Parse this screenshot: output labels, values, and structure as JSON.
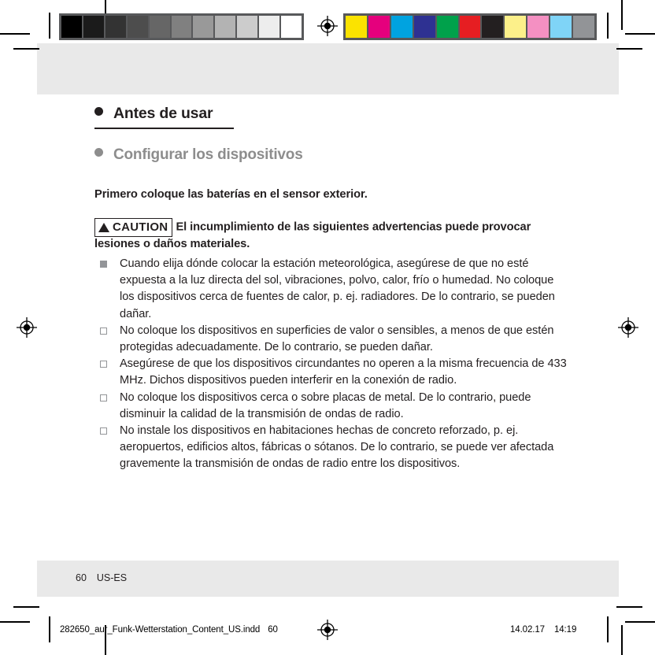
{
  "document": {
    "page_number": "60",
    "language_code": "US-ES"
  },
  "print_strips": {
    "grayscale_label": "grayscale-control-strip",
    "grayscale_swatches": [
      "#000000",
      "#1b1b1b",
      "#333333",
      "#4d4d4d",
      "#666666",
      "#808080",
      "#999999",
      "#b3b3b3",
      "#cccccc",
      "#ededed",
      "#ffffff"
    ],
    "color_label": "color-control-strip",
    "color_swatches": [
      "#fbe300",
      "#e5007d",
      "#00a3e0",
      "#2e3192",
      "#00a14b",
      "#e61e22",
      "#231f20",
      "#fcf08a",
      "#f490c2",
      "#7fd4f7",
      "#929497"
    ]
  },
  "content": {
    "heading1": "Antes de usar",
    "heading2": "Configurar los dispositivos",
    "intro": "Primero coloque las baterías en el sensor exterior.",
    "caution": {
      "word": "CAUTION",
      "text": "El incumplimiento de las siguientes advertencias puede provocar lesiones o daños materiales."
    },
    "bullets": [
      {
        "marker": "filled",
        "text": "Cuando elija dónde colocar la estación meteorológica, asegúrese de que no esté expuesta a la luz directa del sol, vibraciones, polvo, calor, frío o humedad. No coloque los dispositivos cerca de fuentes de calor, p. ej. radiadores. De lo contrario, se pueden dañar."
      },
      {
        "marker": "hollow",
        "text": "No coloque los dispositivos en superficies de valor o sensibles, a menos de que estén protegidas adecuadamente. De lo contrario, se pueden dañar."
      },
      {
        "marker": "hollow",
        "text": "Asegúrese de que los dispositivos circundantes no operen a la misma frecuencia de 433 MHz. Dichos dispositivos pueden interferir en la conexión de radio."
      },
      {
        "marker": "hollow",
        "text": "No coloque los dispositivos cerca o sobre placas de metal. De lo contrario, puede disminuir la calidad de la transmisión de ondas de radio."
      },
      {
        "marker": "hollow",
        "text": "No instale los dispositivos en habitaciones hechas de concreto reforzado, p. ej. aeropuertos, edificios altos, fábricas o sótanos. De lo contrario, se puede ver afectada gravemente la transmisión de ondas de radio entre los dispositivos."
      }
    ]
  },
  "slug": {
    "filename": "282650_aur_Funk-Wetterstation_Content_US.indd",
    "page": "60",
    "date": "14.02.17",
    "time": "14:19"
  }
}
